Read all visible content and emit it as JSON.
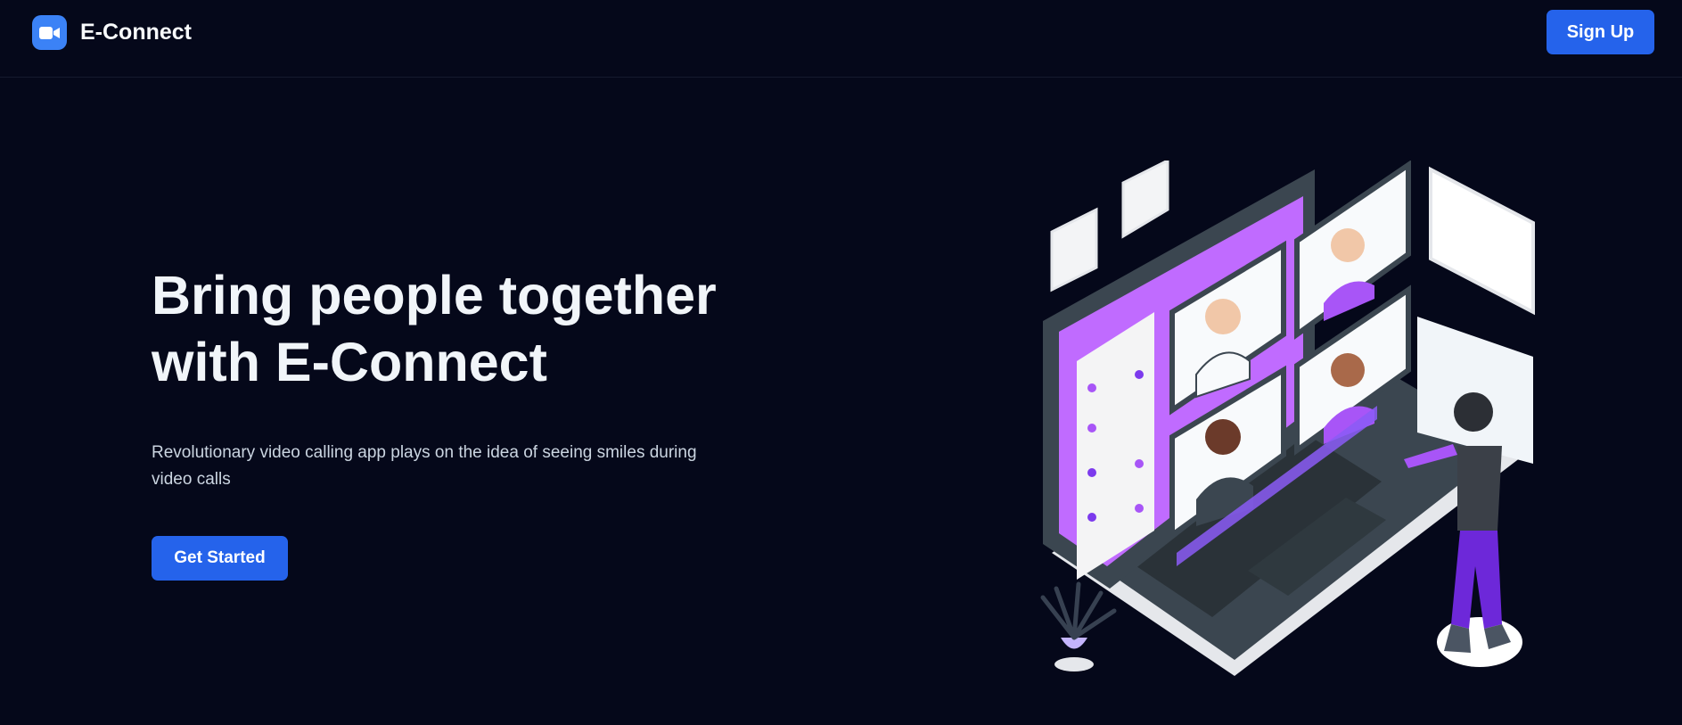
{
  "nav": {
    "brand_name": "E-Connect",
    "logo_icon": "video-camera-icon",
    "signup_label": "Sign Up"
  },
  "hero": {
    "title_line1": "Bring people together",
    "title_line2": "with E-Connect",
    "subtitle": "Revolutionary video calling app plays on the idea of seeing smiles during video calls",
    "cta_label": "Get Started"
  },
  "illustration": {
    "name": "video-call-illustration",
    "colors": {
      "accent": "#c06bff",
      "laptop": "#3b4650",
      "pants": "#6d28d9",
      "button": "#2563eb"
    }
  },
  "colors": {
    "background": "#05081a",
    "primary": "#2563eb",
    "logo": "#3b82f6"
  }
}
